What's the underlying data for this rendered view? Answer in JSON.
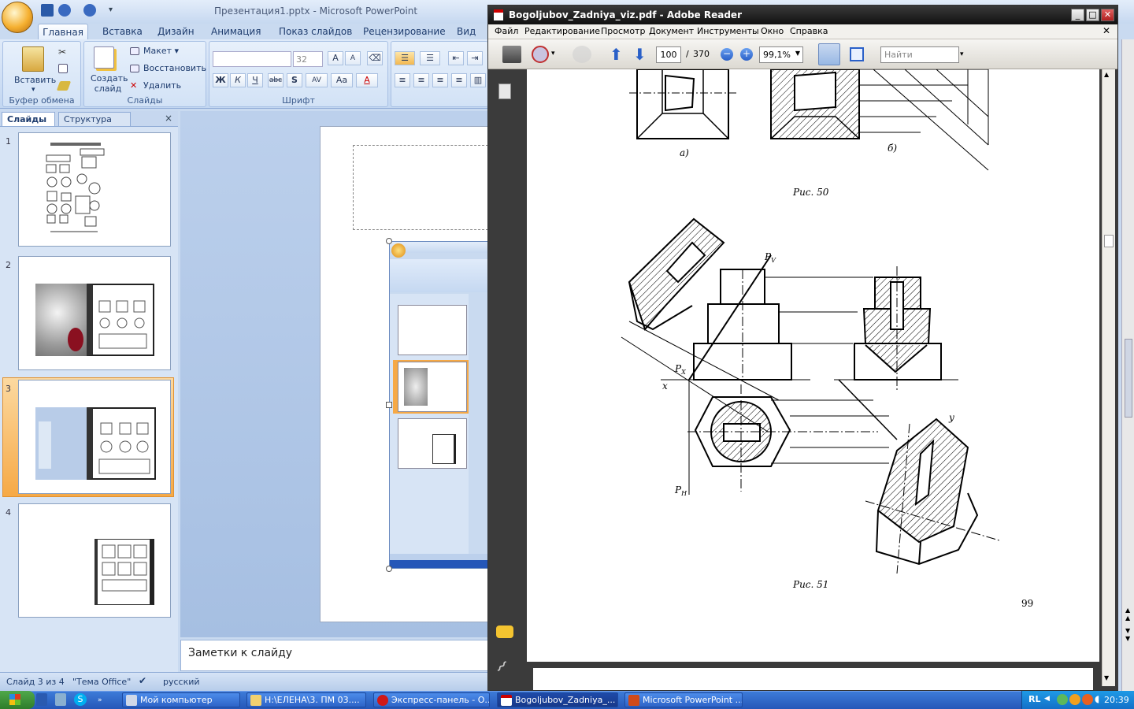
{
  "ppt": {
    "title": "Презентация1.pptx - Microsoft PowerPoint",
    "tabs": [
      "Главная",
      "Вставка",
      "Дизайн",
      "Анимация",
      "Показ слайдов",
      "Рецензирование",
      "Вид"
    ],
    "ribbon": {
      "paste": "Вставить",
      "clipboard_group": "Буфер обмена",
      "new_slide": "Создать слайд",
      "layout": "Макет",
      "reset": "Восстановить",
      "delete": "Удалить",
      "slides_group": "Слайды",
      "font_size": "32",
      "font_group": "Шрифт"
    },
    "panel_tabs": {
      "slides": "Слайды",
      "outline": "Структура"
    },
    "thumb_numbers": [
      "1",
      "2",
      "3",
      "4"
    ],
    "notes": "Заметки к слайду",
    "status": {
      "slide": "Слайд 3 из 4",
      "theme": "\"Тема Office\"",
      "lang": "русский"
    }
  },
  "reader": {
    "title": "Bogoljubov_Zadniya_viz.pdf - Adobe Reader",
    "menu": [
      "Файл",
      "Редактирование",
      "Просмотр",
      "Документ",
      "Инструменты",
      "Окно",
      "Справка"
    ],
    "page_current": "100",
    "page_sep": "/",
    "page_total": "370",
    "zoom": "99,1%",
    "search_placeholder": "Найти",
    "doc": {
      "fig_a": "a)",
      "fig_b": "б)",
      "fig50": "Рис. 50",
      "fig51": "Рис. 51",
      "page_no": "99",
      "pv": "P",
      "pv_sub": "V",
      "px": "P",
      "px_sub": "X",
      "ph": "P",
      "ph_sub": "H",
      "x": "x",
      "y": "y"
    }
  },
  "taskbar": {
    "items": [
      "Мой компьютер",
      "H:\\ЕЛЕНА\\3. ПМ 03....",
      "Экспресс-панель - О...",
      "Bogoljubov_Zadniya_...",
      "Microsoft PowerPoint ..."
    ],
    "lang": "RL",
    "time": "20:39"
  }
}
